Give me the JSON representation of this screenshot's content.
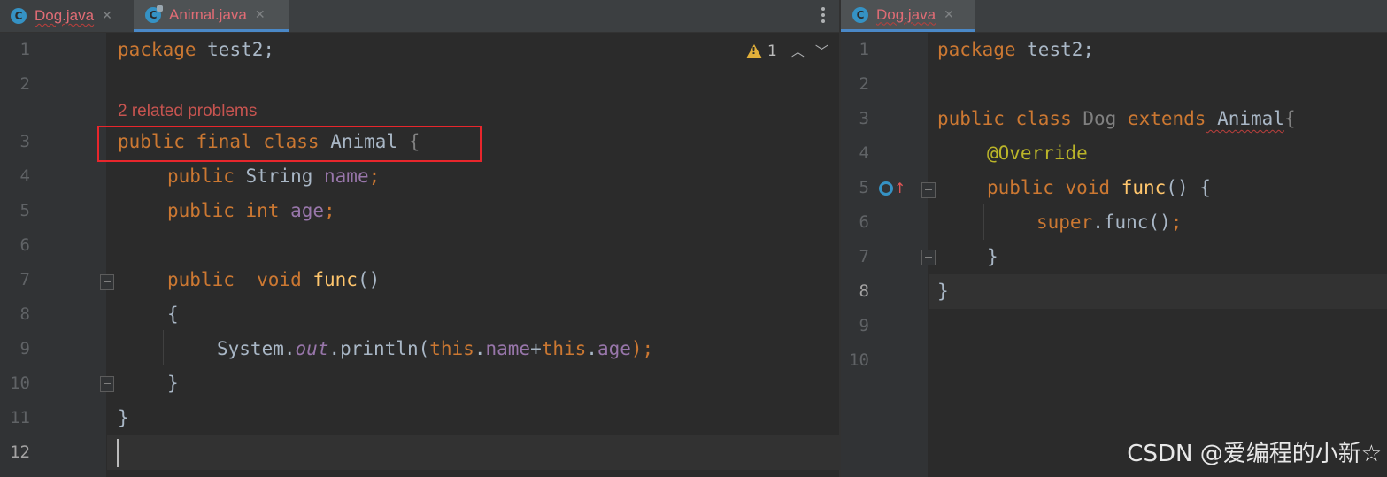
{
  "left_editor": {
    "tabs": [
      {
        "label": "Dog.java",
        "icon": "class-icon",
        "active": false
      },
      {
        "label": "Animal.java",
        "icon": "class-icon",
        "active": true
      }
    ],
    "inspection": {
      "warning_count": "1"
    },
    "problem_hint": "2 related problems",
    "line_numbers": [
      "1",
      "2",
      "3",
      "4",
      "5",
      "6",
      "7",
      "8",
      "9",
      "10",
      "11",
      "12"
    ],
    "lines": {
      "l1": {
        "kw": "package",
        "rest": " test2;"
      },
      "l3": {
        "kw": "public final class",
        "name": " Animal ",
        "brace": "{"
      },
      "l4": {
        "kw": "public",
        "type": " String ",
        "field": "name",
        "end": ";"
      },
      "l5": {
        "kw": "public int",
        "field": " age",
        "end": ";"
      },
      "l7": {
        "kw": "public  void",
        "fn": " func",
        "end": "()"
      },
      "l8": {
        "text": "{"
      },
      "l9": {
        "sys": "System.",
        "st": "out",
        "call": ".println(",
        "this1": "this",
        "dot1": ".",
        "f1": "name",
        "plus": "+",
        "this2": "this",
        "dot2": ".",
        "f2": "age",
        "end": ");"
      },
      "l10": {
        "text": "}"
      },
      "l11": {
        "text": "}"
      }
    }
  },
  "right_editor": {
    "tabs": [
      {
        "label": "Dog.java",
        "icon": "class-icon",
        "active": true
      }
    ],
    "line_numbers": [
      "1",
      "2",
      "3",
      "4",
      "5",
      "6",
      "7",
      "8",
      "9",
      "10"
    ],
    "lines": {
      "l1": {
        "kw": "package",
        "rest": " test2;"
      },
      "l3": {
        "kw": "public class",
        "name": " Dog",
        "kw2": " extends",
        "super": " Animal",
        "brace": "{"
      },
      "l4": {
        "ann": "@Override"
      },
      "l5": {
        "kw": "public void",
        "fn": " func",
        "end": "() {"
      },
      "l6": {
        "kw": "super",
        "call": ".func()",
        "end": ";"
      },
      "l7": {
        "text": "}"
      },
      "l8": {
        "text": "}"
      }
    }
  },
  "watermark": "CSDN @爱编程的小新☆"
}
